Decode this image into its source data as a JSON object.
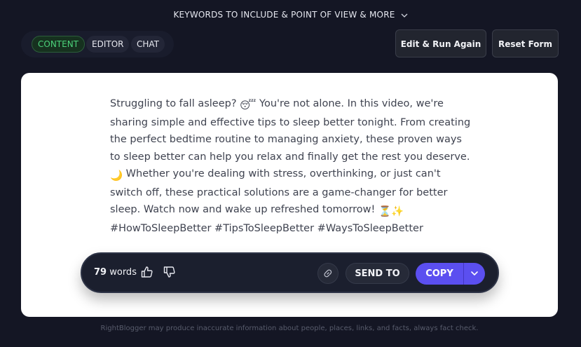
{
  "header": {
    "options_toggle": "KEYWORDS TO INCLUDE & POINT OF VIEW & MORE",
    "options_icon": "chevron-down-icon"
  },
  "tabs": [
    {
      "label": "CONTENT",
      "active": true
    },
    {
      "label": "EDITOR",
      "active": false
    },
    {
      "label": "CHAT",
      "active": false
    }
  ],
  "actions": {
    "edit_run": "Edit & Run Again",
    "reset": "Reset Form"
  },
  "content": {
    "parts": [
      "Struggling to fall asleep? ",
      "😴",
      " You're not alone. In this video, we're sharing simple and effective tips to sleep better tonight. From creating the perfect bedtime routine to managing anxiety, these proven ways to sleep better can help you relax and finally get the rest you deserve. ",
      "🌙",
      " Whether you're dealing with stress, overthinking, or just can't switch off, these practical solutions are a game-changer for better sleep. Watch now and wake up refreshed tomorrow! ",
      "⏳",
      "✨",
      " #HowToSleepBetter #TipsToSleepBetter #WaysToSleepBetter"
    ]
  },
  "toolbar": {
    "word_count": "79",
    "word_unit": "words",
    "thumbs_up_icon": "thumbs-up-icon",
    "thumbs_down_icon": "thumbs-down-icon",
    "link_icon": "link-icon",
    "send_to": "SEND TO",
    "copy": "COPY",
    "copy_menu_icon": "chevron-down-icon"
  },
  "footer": {
    "disclaimer": "RightBlogger may produce inaccurate information about people, places, links, and facts, always fact check."
  },
  "colors": {
    "background": "#141624",
    "accent": "#5b4ff0",
    "active_tab_text": "#4bd17a",
    "card": "#ffffff"
  }
}
